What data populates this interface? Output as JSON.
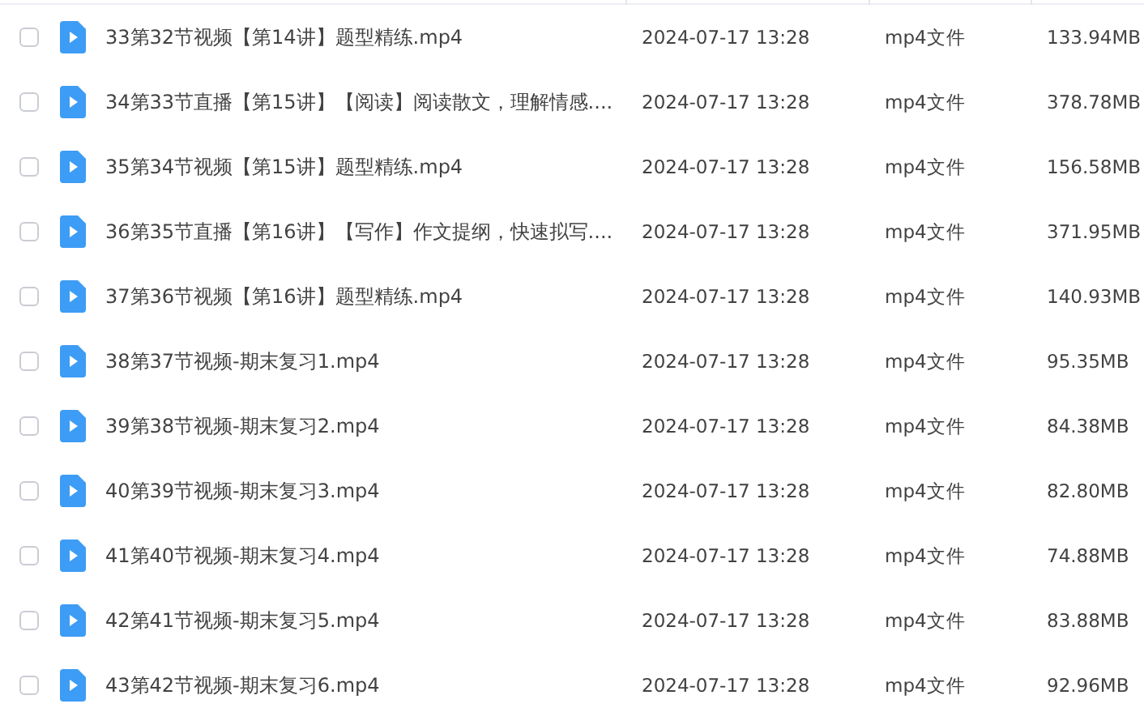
{
  "files": [
    {
      "name": "33第32节视频【第14讲】题型精练.mp4",
      "date": "2024-07-17 13:28",
      "type": "mp4文件",
      "size": "133.94MB",
      "checked": false
    },
    {
      "name": "34第33节直播【第15讲】【阅读】阅读散文，理解情感....",
      "date": "2024-07-17 13:28",
      "type": "mp4文件",
      "size": "378.78MB",
      "checked": false
    },
    {
      "name": "35第34节视频【第15讲】题型精练.mp4",
      "date": "2024-07-17 13:28",
      "type": "mp4文件",
      "size": "156.58MB",
      "checked": false
    },
    {
      "name": "36第35节直播【第16讲】【写作】作文提纲，快速拟写....",
      "date": "2024-07-17 13:28",
      "type": "mp4文件",
      "size": "371.95MB",
      "checked": false
    },
    {
      "name": "37第36节视频【第16讲】题型精练.mp4",
      "date": "2024-07-17 13:28",
      "type": "mp4文件",
      "size": "140.93MB",
      "checked": false
    },
    {
      "name": "38第37节视频-期末复习1.mp4",
      "date": "2024-07-17 13:28",
      "type": "mp4文件",
      "size": "95.35MB",
      "checked": false
    },
    {
      "name": "39第38节视频-期末复习2.mp4",
      "date": "2024-07-17 13:28",
      "type": "mp4文件",
      "size": "84.38MB",
      "checked": false
    },
    {
      "name": "40第39节视频-期末复习3.mp4",
      "date": "2024-07-17 13:28",
      "type": "mp4文件",
      "size": "82.80MB",
      "checked": false
    },
    {
      "name": "41第40节视频-期末复习4.mp4",
      "date": "2024-07-17 13:28",
      "type": "mp4文件",
      "size": "74.88MB",
      "checked": false
    },
    {
      "name": "42第41节视频-期末复习5.mp4",
      "date": "2024-07-17 13:28",
      "type": "mp4文件",
      "size": "83.88MB",
      "checked": false
    },
    {
      "name": "43第42节视频-期末复习6.mp4",
      "date": "2024-07-17 13:28",
      "type": "mp4文件",
      "size": "92.96MB",
      "checked": false
    }
  ]
}
